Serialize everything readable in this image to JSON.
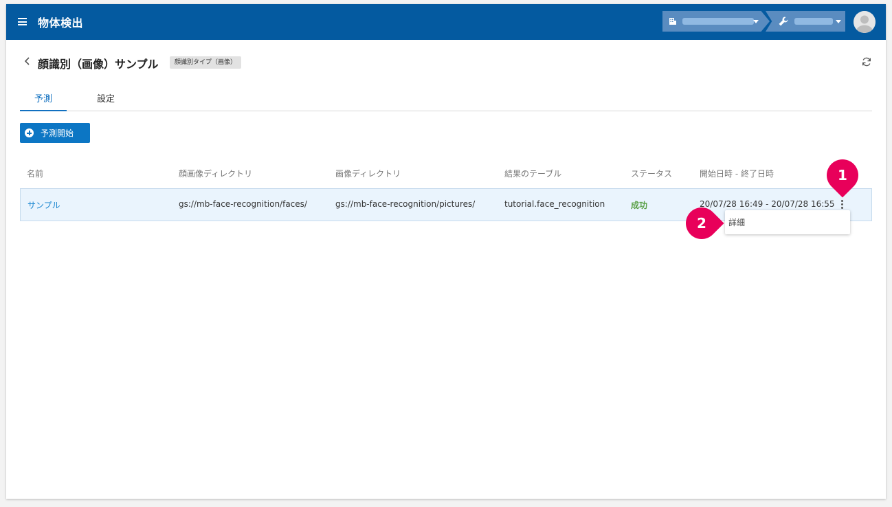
{
  "header": {
    "app_title": "物体検出"
  },
  "page": {
    "title": "顔識別（画像）サンプル",
    "type_badge": "顔識別タイプ（画像）"
  },
  "tabs": [
    {
      "label": "予測"
    },
    {
      "label": "設定"
    }
  ],
  "actions": {
    "start_label": "予測開始"
  },
  "table": {
    "columns": [
      "名前",
      "顔画像ディレクトリ",
      "画像ディレクトリ",
      "結果のテーブル",
      "ステータス",
      "開始日時 - 終了日時"
    ],
    "rows": [
      {
        "name": "サンプル",
        "face_dir": "gs://mb-face-recognition/faces/",
        "image_dir": "gs://mb-face-recognition/pictures/",
        "result_table": "tutorial.face_recognition",
        "status": "成功",
        "datetime": "20/07/28 16:49 - 20/07/28 16:55"
      }
    ]
  },
  "row_menu": {
    "items": [
      {
        "label": "詳細"
      }
    ]
  },
  "callouts": [
    "1",
    "2"
  ],
  "colors": {
    "header": "#045aa0",
    "accent": "#0c76c4",
    "success": "#5aa046",
    "callout": "#e8005a"
  }
}
